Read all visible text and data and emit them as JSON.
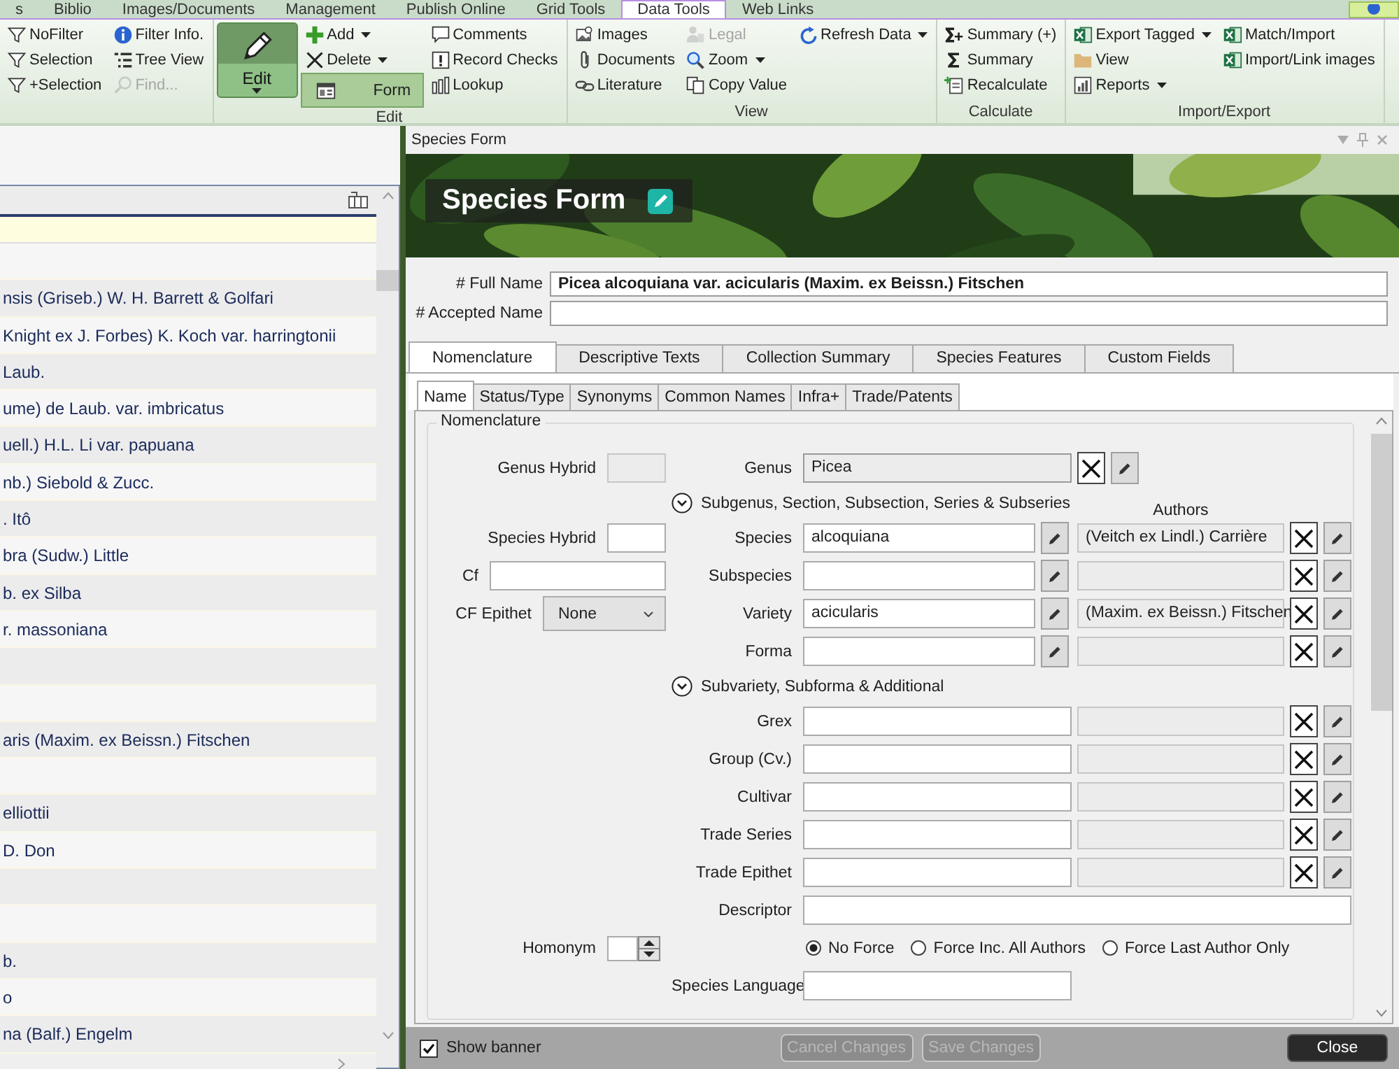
{
  "ribbon_tabs": [
    {
      "label": "s",
      "selected": false
    },
    {
      "label": "Biblio",
      "selected": false
    },
    {
      "label": "Images/Documents",
      "selected": false
    },
    {
      "label": "Management",
      "selected": false
    },
    {
      "label": "Publish Online",
      "selected": false
    },
    {
      "label": "Grid Tools",
      "selected": false
    },
    {
      "label": "Data Tools",
      "selected": true
    },
    {
      "label": "Web Links",
      "selected": false
    }
  ],
  "ribbon_groups": [
    {
      "columns": [
        [
          {
            "label": "NoFilter",
            "disabled": false,
            "selected": false,
            "dropdown": false
          },
          {
            "label": "Selection",
            "disabled": false,
            "selected": false,
            "dropdown": false
          },
          {
            "label": "+Selection",
            "disabled": false,
            "selected": false,
            "dropdown": false
          }
        ],
        [
          {
            "label": "Filter Info.",
            "disabled": false,
            "selected": false,
            "dropdown": false
          },
          {
            "label": "Tree View",
            "disabled": false,
            "selected": false,
            "dropdown": false
          },
          {
            "label": "Find...",
            "disabled": true,
            "selected": false,
            "dropdown": false
          }
        ]
      ]
    },
    {
      "label": "Edit",
      "big_button": {
        "label": "Edit"
      },
      "columns": [
        [
          {
            "label": "Add",
            "disabled": false,
            "selected": false,
            "dropdown": true
          },
          {
            "label": "Delete",
            "disabled": false,
            "selected": false,
            "dropdown": true
          },
          {
            "label": "Form",
            "disabled": false,
            "selected": true,
            "dropdown": false
          }
        ],
        [
          {
            "label": "Comments",
            "disabled": false,
            "selected": false,
            "dropdown": false
          },
          {
            "label": "Record Checks",
            "disabled": false,
            "selected": false,
            "dropdown": false
          },
          {
            "label": "Lookup",
            "disabled": false,
            "selected": false,
            "dropdown": false
          }
        ]
      ]
    },
    {
      "label": "View",
      "columns": [
        [
          {
            "label": "Images",
            "disabled": false,
            "selected": false,
            "dropdown": false
          },
          {
            "label": "Documents",
            "disabled": false,
            "selected": false,
            "dropdown": false
          },
          {
            "label": "Literature",
            "disabled": false,
            "selected": false,
            "dropdown": false
          }
        ],
        [
          {
            "label": "Legal",
            "disabled": true,
            "selected": false,
            "dropdown": false
          },
          {
            "label": "Zoom",
            "disabled": false,
            "selected": false,
            "dropdown": true
          },
          {
            "label": "Copy Value",
            "disabled": false,
            "selected": false,
            "dropdown": false
          }
        ],
        [
          {
            "label": "Refresh Data",
            "disabled": false,
            "selected": false,
            "dropdown": true
          }
        ]
      ]
    },
    {
      "label": "Calculate",
      "columns": [
        [
          {
            "label": "Summary (+)",
            "disabled": false,
            "selected": false,
            "dropdown": false
          },
          {
            "label": "Summary",
            "disabled": false,
            "selected": false,
            "dropdown": false
          },
          {
            "label": "Recalculate",
            "disabled": false,
            "selected": false,
            "dropdown": false
          }
        ]
      ]
    },
    {
      "label": "Import/Export",
      "columns": [
        [
          {
            "label": "Export Tagged",
            "disabled": false,
            "selected": false,
            "dropdown": true
          },
          {
            "label": "View",
            "disabled": false,
            "selected": false,
            "dropdown": false
          },
          {
            "label": "Reports",
            "disabled": false,
            "selected": false,
            "dropdown": true
          }
        ],
        [
          {
            "label": "Match/Import",
            "disabled": false,
            "selected": false,
            "dropdown": false
          },
          {
            "label": "Import/Link images",
            "disabled": false,
            "selected": false,
            "dropdown": false
          }
        ]
      ]
    }
  ],
  "list": {
    "rows": [
      {},
      {
        "text": "nsis (Griseb.) W. H. Barrett & Golfari"
      },
      {
        "text": "Knight ex J. Forbes) K. Koch var. harringtonii"
      },
      {
        "text": "Laub."
      },
      {
        "text": "ume) de Laub. var. imbricatus"
      },
      {
        "text": "uell.) H.L. Li var. papuana"
      },
      {
        "text": "nb.) Siebold & Zucc."
      },
      {
        "text": ". Itô"
      },
      {
        "text": "bra (Sudw.) Little"
      },
      {
        "text": "b. ex Silba"
      },
      {
        "text": "r. massoniana"
      },
      {},
      {},
      {
        "text": "aris (Maxim. ex Beissn.) Fitschen"
      },
      {},
      {
        "text": "elliottii"
      },
      {
        "text": "D. Don"
      },
      {},
      {},
      {
        "text": "b."
      },
      {
        "text": "o"
      },
      {
        "text": "na (Balf.) Engelm"
      }
    ]
  },
  "form": {
    "title": "Species Form",
    "banner_title": "Species Form",
    "full_name": {
      "label": "# Full Name",
      "value": "Picea alcoquiana var. acicularis (Maxim. ex Beissn.) Fitschen"
    },
    "accepted_name": {
      "label": "# Accepted Name"
    },
    "tabs": [
      {
        "label": "Nomenclature",
        "selected": true
      },
      {
        "label": "Descriptive Texts",
        "selected": false
      },
      {
        "label": "Collection Summary",
        "selected": false
      },
      {
        "label": "Species Features",
        "selected": false
      },
      {
        "label": "Custom Fields",
        "selected": false
      }
    ],
    "subtabs": [
      {
        "label": "Name",
        "selected": true
      },
      {
        "label": "Status/Type",
        "selected": false
      },
      {
        "label": "Synonyms",
        "selected": false
      },
      {
        "label": "Common Names",
        "selected": false
      },
      {
        "label": "Infra+",
        "selected": false
      },
      {
        "label": "Trade/Patents",
        "selected": false
      }
    ],
    "nomenclature": {
      "title": "Nomenclature",
      "rows": [
        {
          "kind": "locked",
          "label": "Genus",
          "value": "Picea",
          "side": {
            "kind": "box",
            "label": "Genus Hybrid",
            "disabled": true
          }
        },
        {
          "kind": "section",
          "label": "Subgenus, Section, Subsection, Series & Subseries",
          "authors_heading": "Authors"
        },
        {
          "kind": "epithet",
          "label": "Species",
          "value": "alcoquiana",
          "authors": "(Veitch ex Lindl.) Carrière",
          "side": {
            "kind": "box",
            "label": "Species Hybrid",
            "disabled": false
          }
        },
        {
          "kind": "epithet",
          "label": "Subspecies",
          "side": {
            "kind": "wide",
            "label": "Cf"
          }
        },
        {
          "kind": "epithet",
          "label": "Variety",
          "value": "acicularis",
          "authors": "(Maxim. ex Beissn.) Fitschen",
          "side": {
            "kind": "select",
            "label": "CF Epithet",
            "value": "None"
          }
        },
        {
          "kind": "epithet",
          "label": "Forma"
        },
        {
          "kind": "section",
          "label": "Subvariety, Subforma & Additional"
        },
        {
          "kind": "cultivar",
          "label": "Grex"
        },
        {
          "kind": "cultivar",
          "label": "Group (Cv.)"
        },
        {
          "kind": "cultivar",
          "label": "Cultivar"
        },
        {
          "kind": "cultivar",
          "label": "Trade Series"
        },
        {
          "kind": "cultivar",
          "label": "Trade Epithet"
        },
        {
          "kind": "full",
          "label": "Descriptor"
        },
        {
          "kind": "radios",
          "options": [
            {
              "label": "No Force",
              "selected": true
            },
            {
              "label": "Force Inc. All Authors",
              "selected": false
            },
            {
              "label": "Force Last Author Only",
              "selected": false
            }
          ],
          "side": {
            "kind": "spinner",
            "label": "Homonym"
          }
        },
        {
          "kind": "plain",
          "label": "Species Language"
        }
      ]
    },
    "footer": {
      "show_banner": {
        "label": "Show banner",
        "checked": true
      },
      "buttons": [
        {
          "label": "Cancel Changes",
          "disabled": true
        },
        {
          "label": "Save Changes",
          "disabled": true
        },
        {
          "label": "Close",
          "disabled": false
        }
      ]
    }
  }
}
